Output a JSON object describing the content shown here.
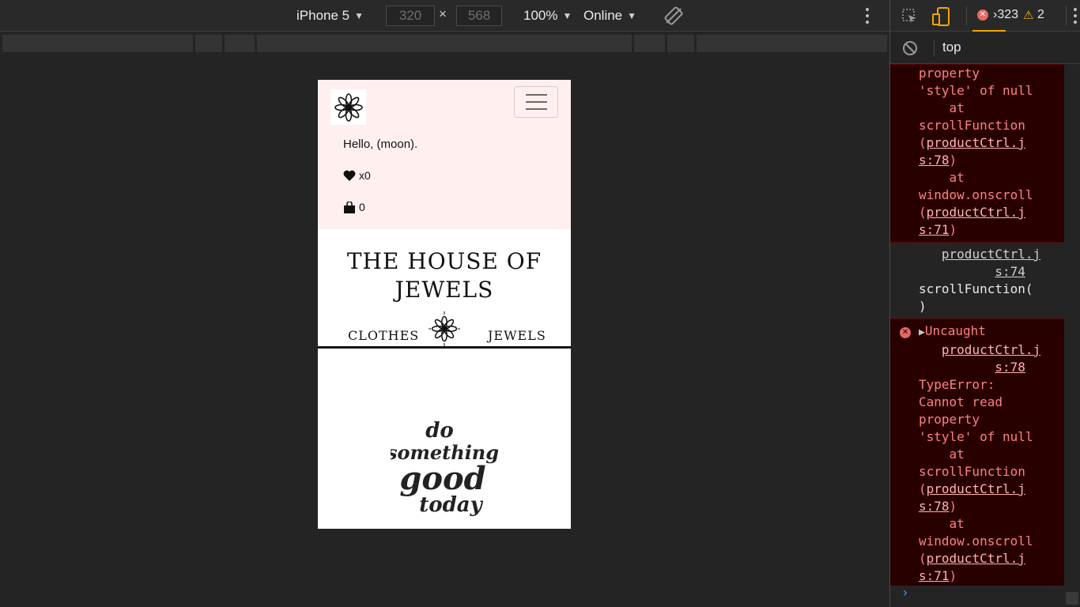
{
  "device_toolbar": {
    "device": "iPhone 5",
    "width": "320",
    "height": "568",
    "times": "×",
    "zoom": "100%",
    "network": "Online"
  },
  "page": {
    "greeting": "Hello, (moon).",
    "favorites": "x0",
    "bag": "0",
    "title": "THE HOUSE OF JEWELS",
    "menu_left": "CLOTHES",
    "menu_right": "JEWELS",
    "quote": [
      "do",
      "something",
      "good",
      "today"
    ]
  },
  "devtools": {
    "error_count": "323",
    "warning_count": "2",
    "context": "top",
    "messages": [
      {
        "type": "error",
        "lines": [
          {
            "text": "property"
          },
          {
            "text": "'style' of null"
          },
          {
            "text": "    at"
          },
          {
            "text": "scrollFunction"
          },
          {
            "text": "(",
            "link": "productCtrl.j"
          },
          {
            "link": "s:78",
            "after": ")"
          },
          {
            "text": "    at"
          },
          {
            "text": "window.onscroll"
          },
          {
            "text": "(",
            "link": "productCtrl.j"
          },
          {
            "link": "s:71",
            "after": ")"
          }
        ]
      },
      {
        "type": "plain",
        "lines": [
          {
            "text": "   ",
            "link": "productCtrl.j"
          },
          {
            "text": "          ",
            "link": "s:74"
          },
          {
            "text": "scrollFunction("
          },
          {
            "text": ")"
          }
        ]
      },
      {
        "type": "error",
        "icon": true,
        "lines": [
          {
            "text": "Uncaught",
            "triangle": true
          },
          {
            "text": "   ",
            "link": "productCtrl.j"
          },
          {
            "text": "          ",
            "link": "s:78"
          },
          {
            "text": "TypeError:"
          },
          {
            "text": "Cannot read"
          },
          {
            "text": "property"
          },
          {
            "text": "'style' of null"
          },
          {
            "text": "    at"
          },
          {
            "text": "scrollFunction"
          },
          {
            "text": "(",
            "link": "productCtrl.j"
          },
          {
            "link": "s:78",
            "after": ")"
          },
          {
            "text": "    at"
          },
          {
            "text": "window.onscroll"
          },
          {
            "text": "(",
            "link": "productCtrl.j"
          },
          {
            "link": "s:71",
            "after": ")"
          }
        ]
      }
    ],
    "prompt": "›"
  },
  "colors": {
    "navbar_bg": "#fff0ef",
    "error_bg": "#290000",
    "error_text": "#ff8080",
    "warning": "#f2ab26",
    "accent": "#f2a600"
  },
  "icons": [
    "inspect-icon",
    "device-toggle-icon",
    "clear-console-icon",
    "rotate-icon",
    "heart-icon",
    "shopping-bag-icon",
    "flower-logo-icon",
    "hamburger-icon"
  ]
}
